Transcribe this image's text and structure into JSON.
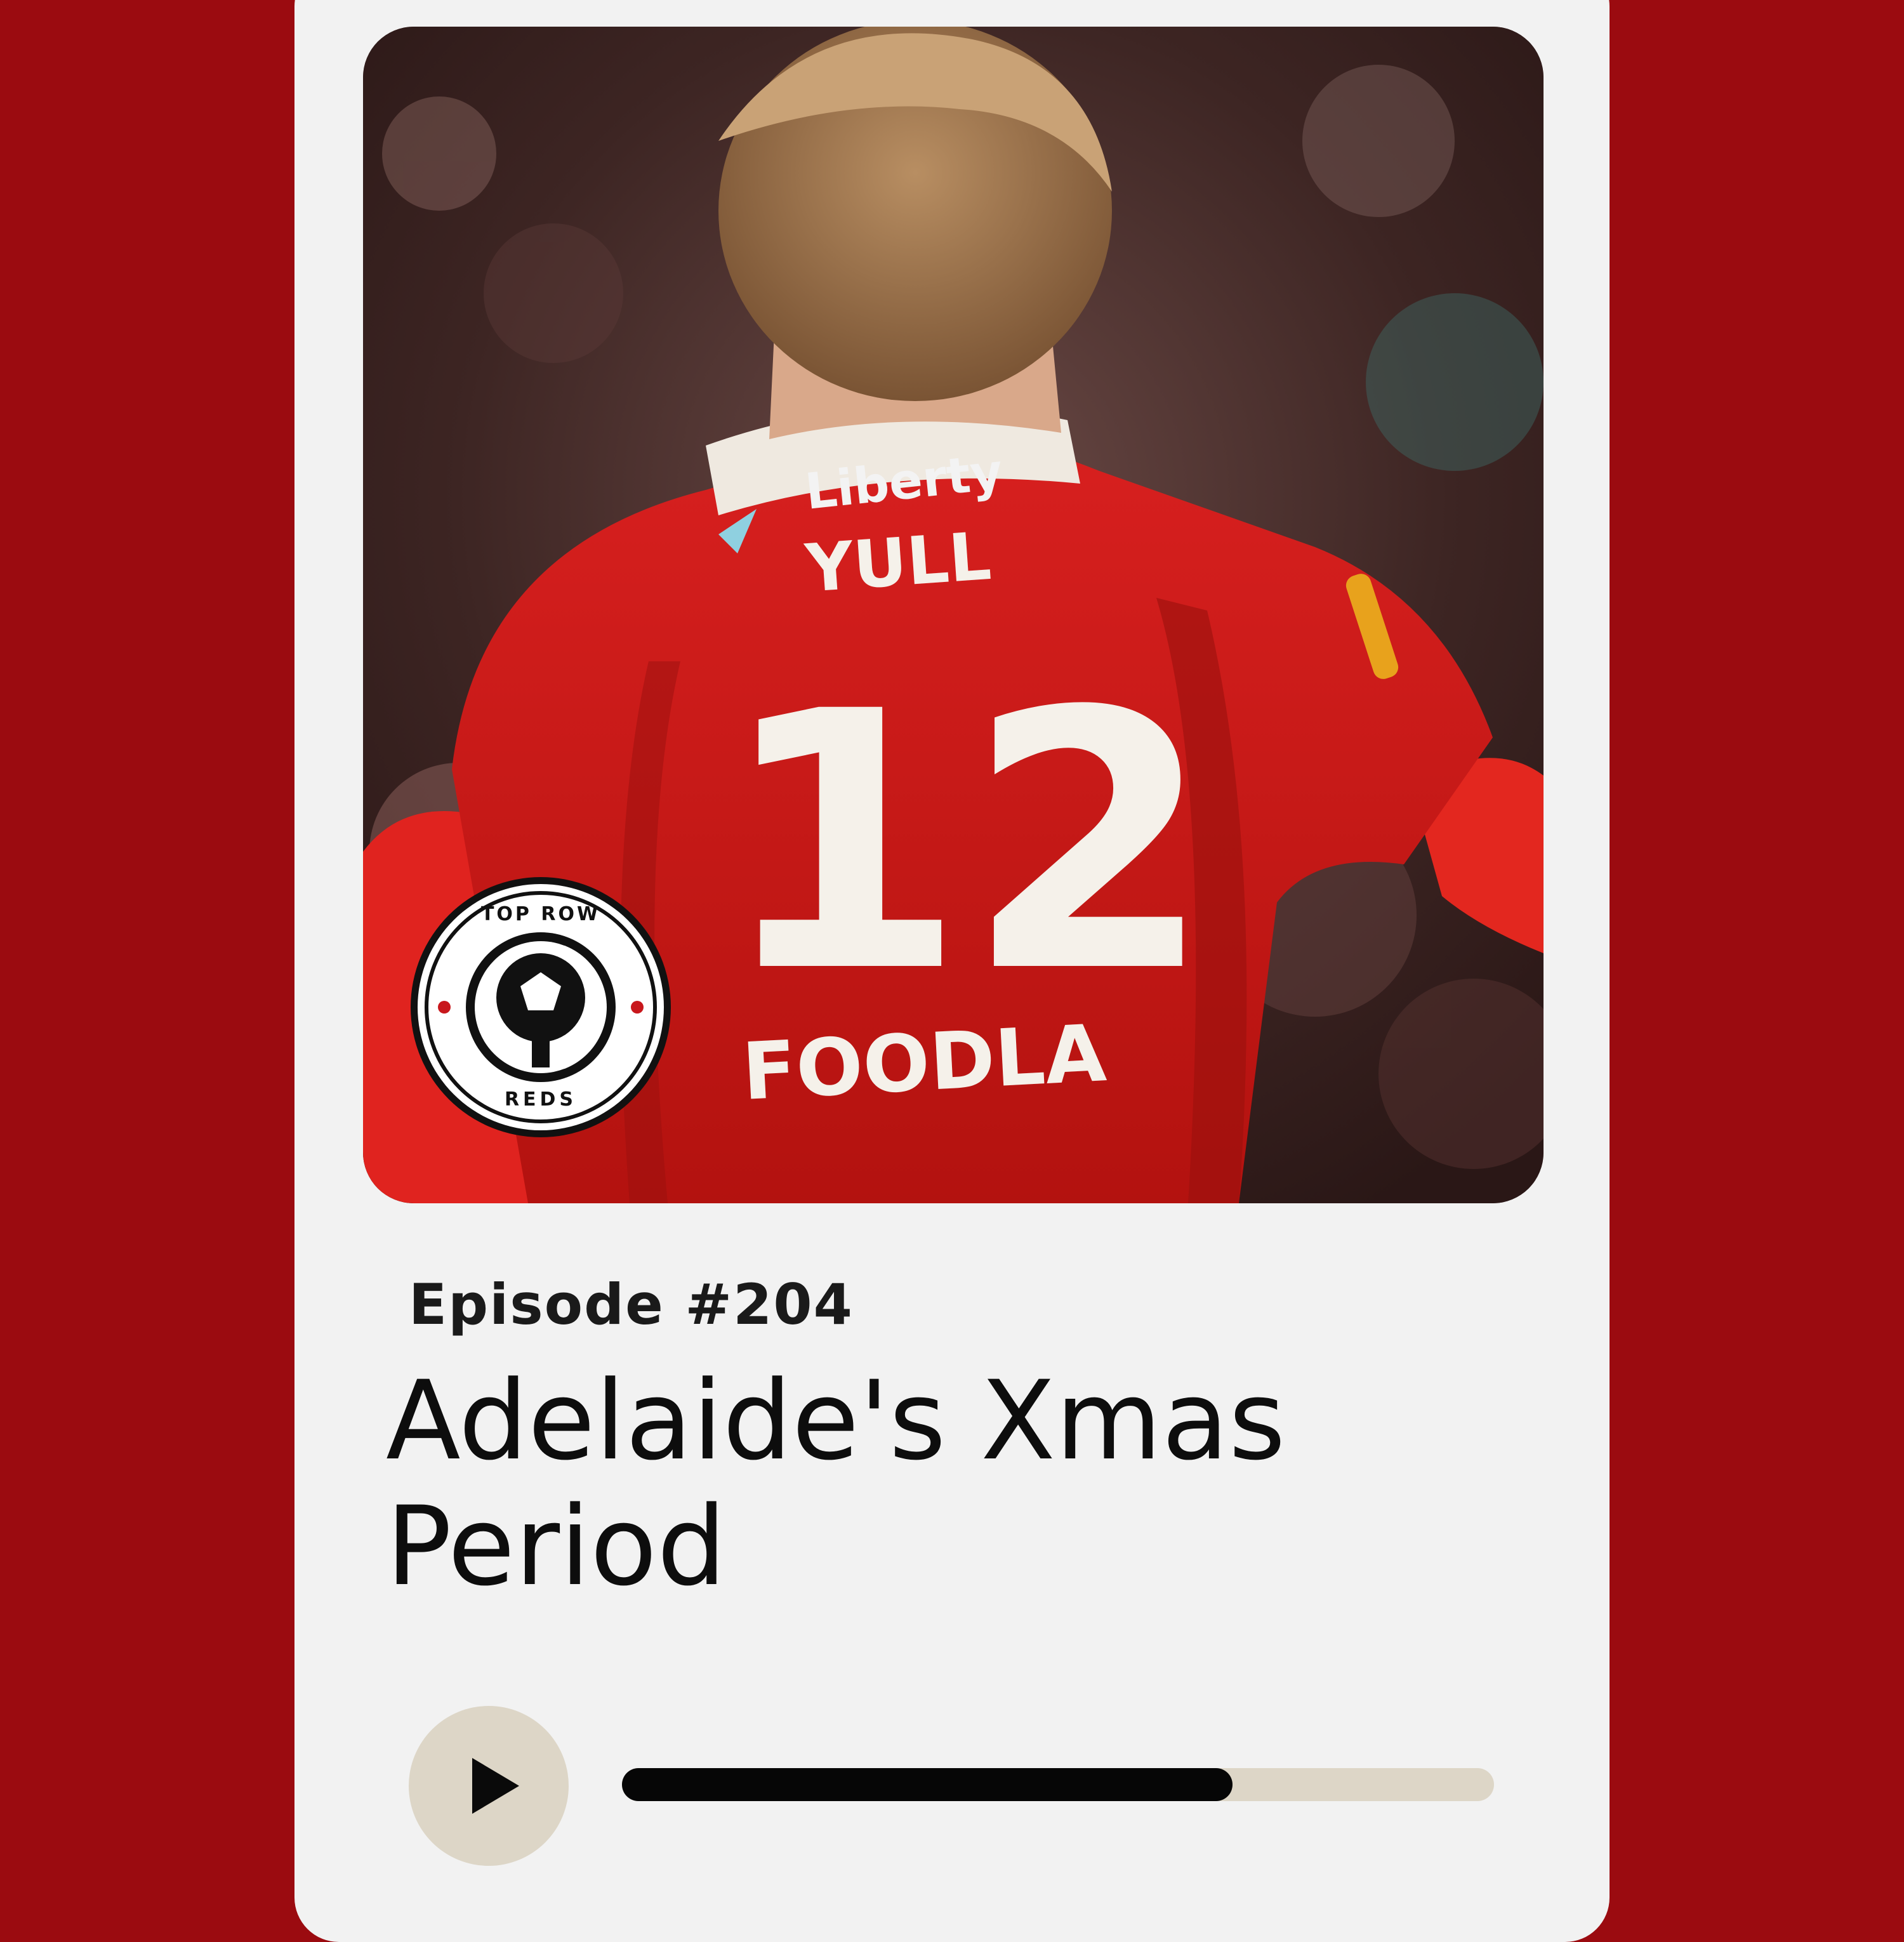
{
  "episode": {
    "label": "Episode #204",
    "title": "Adelaide's Xmas Period"
  },
  "artwork": {
    "jersey_sponsor_top": "Liberty",
    "player_name": "YULL",
    "player_number": "12",
    "jersey_sponsor_bottom": "FOODLA",
    "logo_text_top": "TOP ROW",
    "logo_text_bottom": "REDS"
  },
  "player": {
    "progress_fraction": 0.7,
    "play_icon": "play-icon"
  },
  "colors": {
    "background": "#9b0b10",
    "card": "#f2f2f2",
    "button": "#ddd6c7",
    "progress_fill": "#060606"
  }
}
